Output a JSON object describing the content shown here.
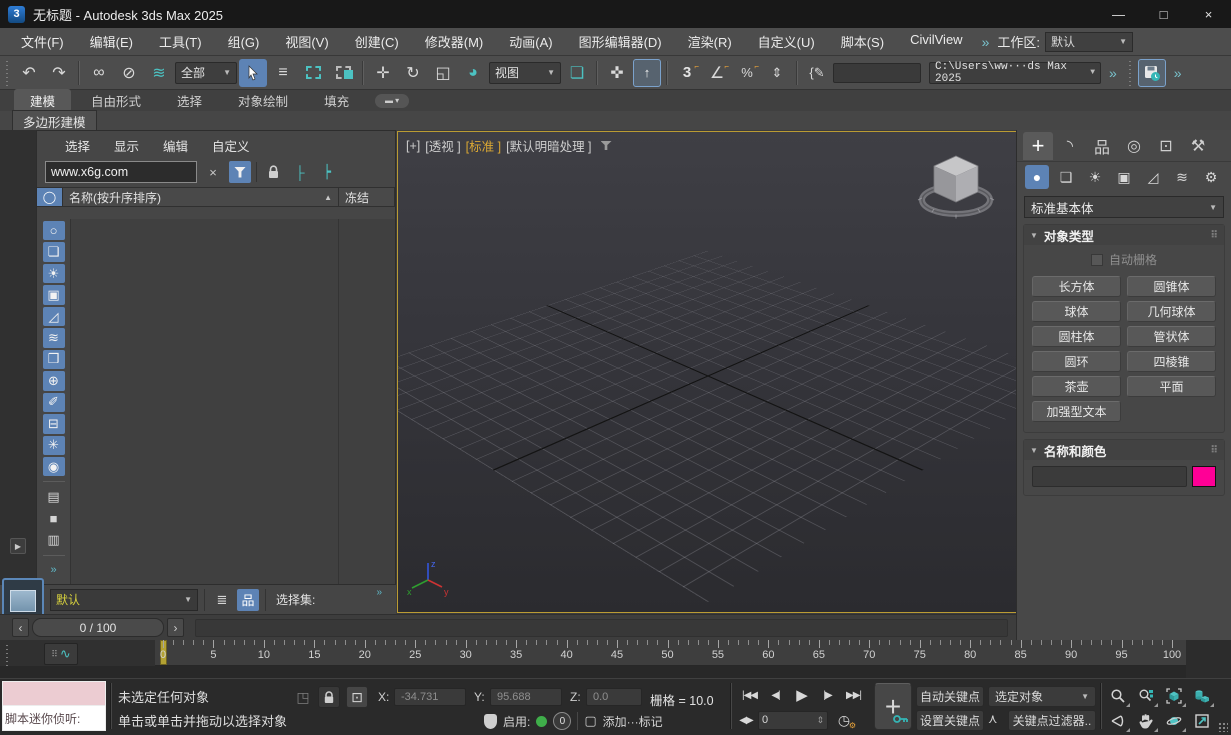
{
  "window": {
    "title": "无标题 - Autodesk 3ds Max 2025",
    "app_badge": "3"
  },
  "menu_bar": {
    "items": [
      "文件(F)",
      "编辑(E)",
      "工具(T)",
      "组(G)",
      "视图(V)",
      "创建(C)",
      "修改器(M)",
      "动画(A)",
      "图形编辑器(D)",
      "渲染(R)",
      "自定义(U)",
      "脚本(S)",
      "CivilView"
    ],
    "overflow": "»",
    "workspace_label": "工作区:",
    "workspace_value": "默认"
  },
  "toolbar": {
    "selection_filter_value": "全部",
    "coord_system_value": "视图",
    "project_path_value": "C:\\Users\\ww···ds Max 2025"
  },
  "ribbon": {
    "tabs": [
      "建模",
      "自由形式",
      "选择",
      "对象绘制",
      "填充"
    ],
    "active_tab": "建模",
    "panel_tab": "多边形建模"
  },
  "explorer": {
    "menus": [
      "选择",
      "显示",
      "编辑",
      "自定义"
    ],
    "search_value": "www.x6g.com",
    "column_name": "名称(按升序排序)",
    "column_frozen": "冻结",
    "display_toggles": [
      {
        "name": "display-none-toggle",
        "glyph": "○"
      },
      {
        "name": "display-geometry-toggle",
        "glyph": "❏"
      },
      {
        "name": "display-lights-toggle",
        "glyph": "☀"
      },
      {
        "name": "display-cameras-toggle",
        "glyph": "▣"
      },
      {
        "name": "display-helpers-toggle",
        "glyph": "◿"
      },
      {
        "name": "display-space-warps-toggle",
        "glyph": "≋"
      },
      {
        "name": "display-groups-toggle",
        "glyph": "❒"
      },
      {
        "name": "display-xrefs-toggle",
        "glyph": "⊕"
      },
      {
        "name": "display-bones-toggle",
        "glyph": "✐"
      },
      {
        "name": "display-containers-toggle",
        "glyph": "⊟"
      },
      {
        "name": "display-frozen-toggle",
        "glyph": "✳"
      },
      {
        "name": "display-hidden-toggle",
        "glyph": "◉"
      }
    ],
    "extra_buttons": [
      {
        "name": "explorer-list-view-button",
        "glyph": "▤"
      },
      {
        "name": "explorer-blank-button",
        "glyph": "■"
      },
      {
        "name": "explorer-detail-view-button",
        "glyph": "▥"
      }
    ],
    "collapse": "»"
  },
  "layer_bar": {
    "layer_value": "默认",
    "selection_set_label": "选择集:",
    "overflow": "»"
  },
  "time_slider": {
    "frame_display": "0 / 100"
  },
  "track_bar": {
    "start": 0,
    "end": 100,
    "number_step": 5,
    "current_frame": 0
  },
  "viewport": {
    "label_nav": "[+]",
    "label_pov": "[透视 ]",
    "label_style": "[标准 ]",
    "label_shading": "[默认明暗处理 ]",
    "axis_x": "x",
    "axis_y": "y",
    "axis_z": "z"
  },
  "command_panel": {
    "category_dropdown_value": "标准基本体",
    "rollout_object_type": "对象类型",
    "autogrid_label": "自动栅格",
    "object_buttons": [
      "长方体",
      "圆锥体",
      "球体",
      "几何球体",
      "圆柱体",
      "管状体",
      "圆环",
      "四棱锥",
      "茶壶",
      "平面",
      "加强型文本"
    ],
    "rollout_name_color": "名称和颜色",
    "object_color": "#ff0096"
  },
  "status_bar": {
    "listener_label": "脚本迷你侦听:",
    "prompt_line1": "未选定任何对象",
    "prompt_line2": "单击或单击并拖动以选择对象",
    "x_label": "X:",
    "x_value": "-34.731",
    "y_label": "Y:",
    "y_value": "95.688",
    "z_label": "Z:",
    "z_value": "0.0",
    "grid_label": "栅格 = 10.0",
    "enable_label": "启用:",
    "scripts_count": "0",
    "add_tag_label": "添加···标记",
    "frame_value": "0",
    "auto_key_label": "自动关键点",
    "set_key_label": "设置关键点",
    "selected_label": "选定对象",
    "key_filters_label": "关键点过滤器.."
  },
  "icons": {
    "minimize": "—",
    "maximize": "□",
    "close": "×",
    "undo": "↶",
    "redo": "↷",
    "link": "∞",
    "unlink": "⊘",
    "bind_spacewarp": "≋",
    "select_by_name": "≡",
    "move": "✛",
    "rotate": "↻",
    "scale": "◱",
    "place": "◕",
    "pivot_center": "❏",
    "manipulate": "✜",
    "kbd_override": "↑",
    "snap": "3",
    "angle_snap": "∠",
    "percent_snap": "%",
    "spinner_snap": "⇕",
    "script_braces": "{✎",
    "overflow": "»",
    "clear": "×",
    "sort_asc": "▲",
    "header_circle": "◯",
    "tree_expand": "├",
    "tree_collapse": "┝",
    "layers": "≣",
    "hierarchy_mini": "品",
    "expand_arrow": "▶",
    "prev": "‹",
    "next": "›",
    "curve_editor": "∿",
    "list_dots": "⠿",
    "cp_create": "+",
    "cp_modify": "◝",
    "cp_hierarchy": "品",
    "cp_motion": "◎",
    "cp_display": "⊡",
    "cp_utilities": "⚒",
    "cat_geometry": "●",
    "cat_shapes": "❏",
    "cat_lights": "☀",
    "cat_cameras": "▣",
    "cat_helpers": "◿",
    "cat_spacewarps": "≋",
    "cat_systems": "⚙",
    "rollout_arrow": "▼",
    "dropdown": "▼",
    "go_start": "|◀◀",
    "prev_frame": "◀|",
    "play": "▶",
    "next_frame": "|▶",
    "go_end": "▶▶|",
    "key_mode": "◀▶",
    "time_config": "◷",
    "isolate": "◳",
    "abs_offset": "⊡",
    "cube_tag": "▢",
    "dot": "●",
    "tangent": "⋏",
    "spinner": "⇕"
  }
}
